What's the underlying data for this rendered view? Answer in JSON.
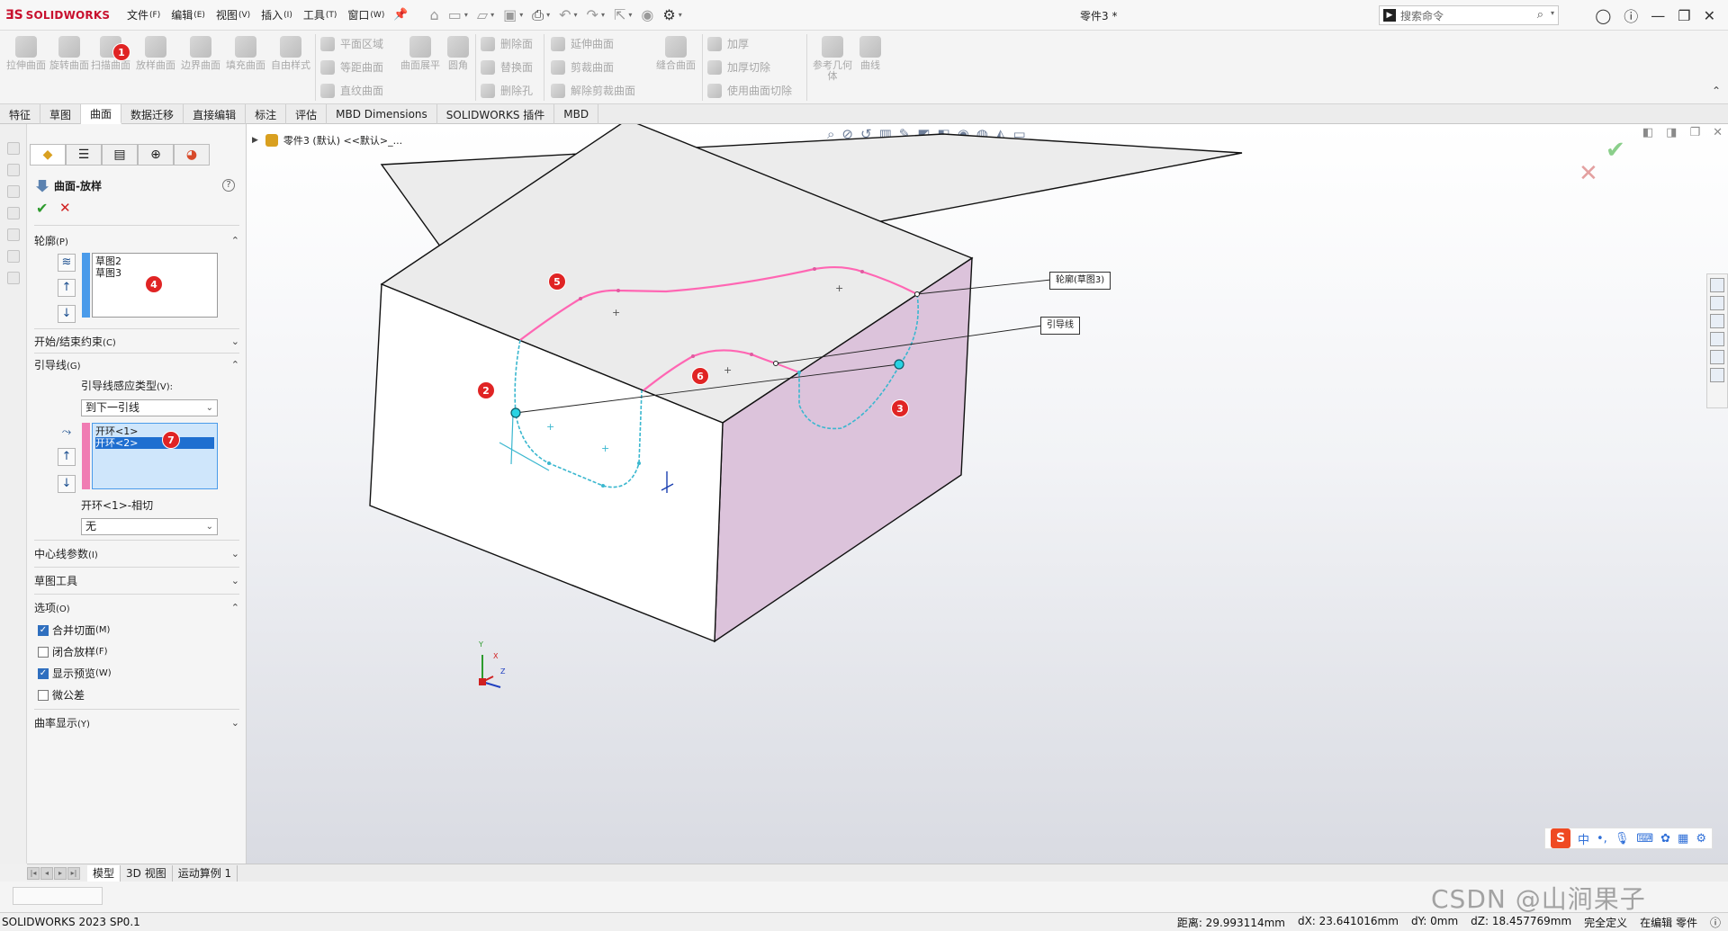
{
  "app": {
    "brand": "SOLIDWORKS",
    "document_title": "零件3 *",
    "menu": [
      {
        "label": "文件",
        "key": "(F)"
      },
      {
        "label": "编辑",
        "key": "(E)"
      },
      {
        "label": "视图",
        "key": "(V)"
      },
      {
        "label": "插入",
        "key": "(I)"
      },
      {
        "label": "工具",
        "key": "(T)"
      },
      {
        "label": "窗口",
        "key": "(W)"
      }
    ],
    "search_placeholder": "搜索命令"
  },
  "command_manager": {
    "big_buttons": [
      {
        "label": "拉伸曲面"
      },
      {
        "label": "旋转曲面"
      },
      {
        "label": "扫描曲面"
      },
      {
        "label": "放样曲面"
      },
      {
        "label": "边界曲面"
      },
      {
        "label": "填充曲面"
      },
      {
        "label": "自由样式"
      },
      {
        "label": "曲面展平"
      },
      {
        "label": "圆角"
      },
      {
        "label": "缝合曲面"
      },
      {
        "label": "参考几何体"
      },
      {
        "label": "曲线"
      }
    ],
    "small_buttons": [
      {
        "label": "平面区域"
      },
      {
        "label": "等距曲面"
      },
      {
        "label": "直纹曲面"
      },
      {
        "label": "删除面"
      },
      {
        "label": "替换面"
      },
      {
        "label": "删除孔"
      },
      {
        "label": "延伸曲面"
      },
      {
        "label": "剪裁曲面"
      },
      {
        "label": "解除剪裁曲面"
      },
      {
        "label": "加厚"
      },
      {
        "label": "加厚切除"
      },
      {
        "label": "使用曲面切除"
      }
    ]
  },
  "tabs": [
    {
      "label": "特征"
    },
    {
      "label": "草图"
    },
    {
      "label": "曲面",
      "active": true
    },
    {
      "label": "数据迁移"
    },
    {
      "label": "直接编辑"
    },
    {
      "label": "标注"
    },
    {
      "label": "评估"
    },
    {
      "label": "MBD Dimensions"
    },
    {
      "label": "SOLIDWORKS 插件"
    },
    {
      "label": "MBD"
    }
  ],
  "property_manager": {
    "title": "曲面-放样",
    "profiles": {
      "header": "轮廓",
      "key": "(P)",
      "items": [
        "草图2",
        "草图3"
      ]
    },
    "start_end": {
      "header": "开始/结束约束",
      "key": "(C)"
    },
    "guides": {
      "header": "引导线",
      "key": "(G)",
      "influence_label": "引导线感应类型",
      "influence_key": "(V):",
      "influence_value": "到下一引线",
      "items": [
        "开环<1>",
        "开环<2>"
      ],
      "tangent_label": "开环<1>-相切",
      "tangent_value": "无"
    },
    "centerline": {
      "header": "中心线参数",
      "key": "(I)"
    },
    "sketch_tools": {
      "header": "草图工具"
    },
    "options": {
      "header": "选项",
      "key": "(O)",
      "checks": [
        {
          "label": "合并切面",
          "key": "(M)",
          "checked": true
        },
        {
          "label": "闭合放样",
          "key": "(F)",
          "checked": false
        },
        {
          "label": "显示预览",
          "key": "(W)",
          "checked": true
        },
        {
          "label": "微公差",
          "key": "",
          "checked": false
        }
      ]
    },
    "curvature": {
      "header": "曲率显示",
      "key": "(Y)"
    }
  },
  "viewport": {
    "tree_item": "零件3 (默认) <<默认>_...",
    "callouts": {
      "profile": "轮廓(草图3)",
      "guide": "引导线"
    },
    "triad": {
      "x": "X",
      "y": "Y",
      "z": "Z"
    }
  },
  "annotations": [
    "1",
    "2",
    "3",
    "4",
    "5",
    "6",
    "7"
  ],
  "bottom_tabs": [
    {
      "label": "模型",
      "active": true
    },
    {
      "label": "3D 视图"
    },
    {
      "label": "运动算例 1"
    }
  ],
  "status": {
    "version": "SOLIDWORKS 2023 SP0.1",
    "distance": "距离: 29.993114mm",
    "dx": "dX: 23.641016mm",
    "dy": "dY: 0mm",
    "dz": "dZ: 18.457769mm",
    "state": "完全定义",
    "mode": "在编辑 零件"
  },
  "ime": {
    "lang": "中"
  },
  "watermark": "CSDN @山涧果子",
  "colors": {
    "brand_red": "#c8102e",
    "guide_cyan": "#3ab7cf",
    "profile_pink": "#ff66b3",
    "side_face": "#dcc3db",
    "badge_red": "#e02424"
  }
}
